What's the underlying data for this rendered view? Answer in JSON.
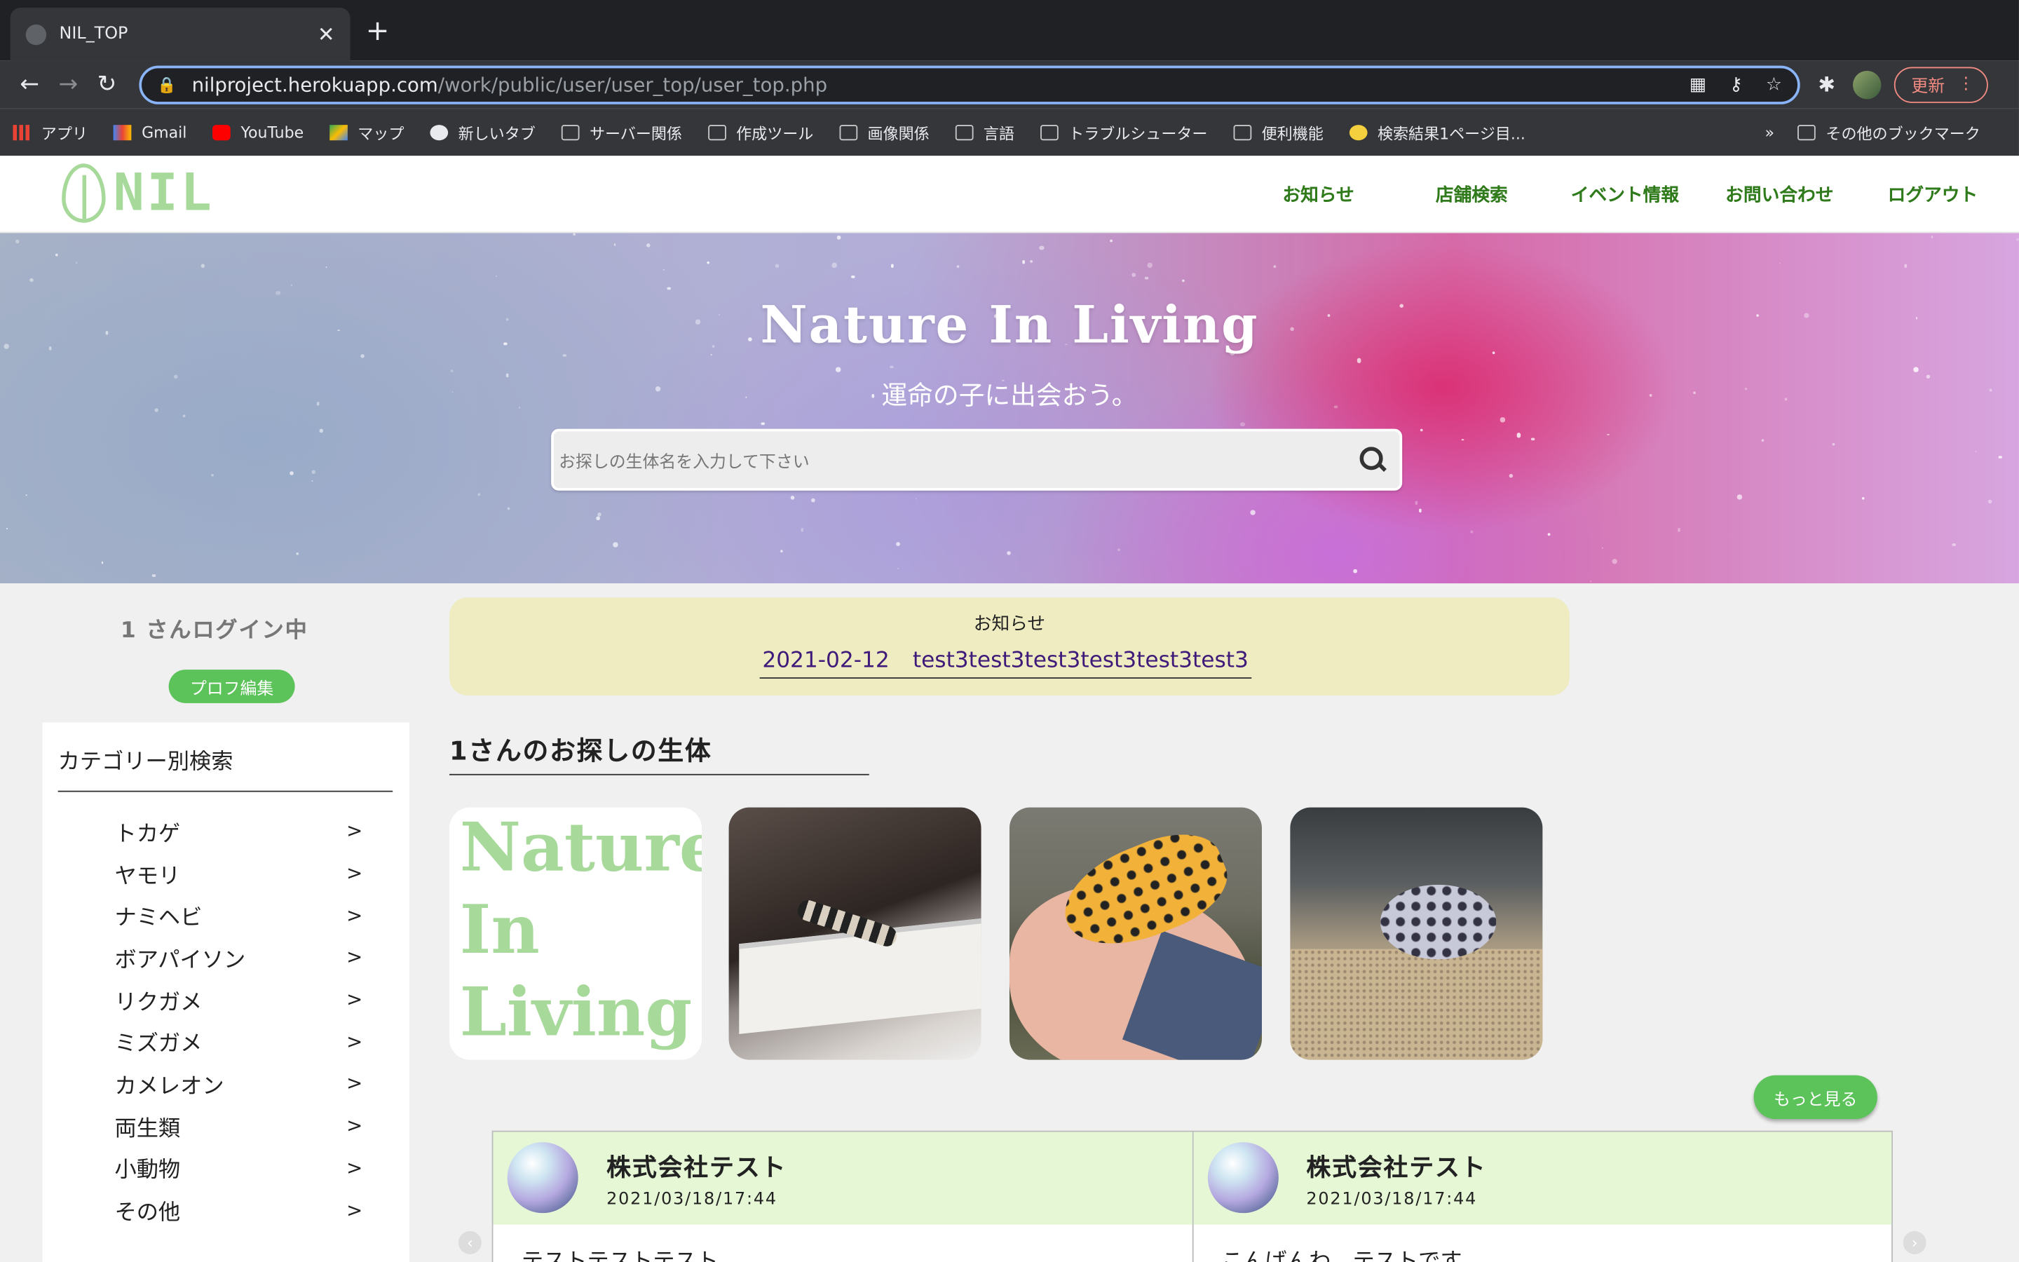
{
  "browser": {
    "tab_title": "NIL_TOP",
    "url_host": "nilproject.herokuapp.com",
    "url_path": "/work/public/user/user_top/user_top.php",
    "update_label": "更新",
    "bookmarks": [
      {
        "label": "アプリ",
        "icon": "apps-grid-icon"
      },
      {
        "label": "Gmail",
        "icon": "gmail-icon"
      },
      {
        "label": "YouTube",
        "icon": "youtube-icon"
      },
      {
        "label": "マップ",
        "icon": "maps-icon"
      },
      {
        "label": "新しいタブ",
        "icon": "globe-icon"
      },
      {
        "label": "サーバー関係",
        "icon": "folder-icon"
      },
      {
        "label": "作成ツール",
        "icon": "folder-icon"
      },
      {
        "label": "画像関係",
        "icon": "folder-icon"
      },
      {
        "label": "言語",
        "icon": "folder-icon"
      },
      {
        "label": "トラブルシューター",
        "icon": "folder-icon"
      },
      {
        "label": "便利機能",
        "icon": "folder-icon"
      },
      {
        "label": "検索結果1ページ目...",
        "icon": "smile-icon"
      }
    ],
    "more_bookmarks": "»",
    "other_bookmarks": "その他のブックマーク"
  },
  "site": {
    "logo_text": "NIL",
    "nav": [
      "お知らせ",
      "店舗検索",
      "イベント情報",
      "お問い合わせ",
      "ログアウト"
    ],
    "accent_color": "#5cc25a",
    "nav_color": "#2f7a1a"
  },
  "hero": {
    "title": "Nature In Living",
    "tagline": "運命の子に出会おう。",
    "search_placeholder": "お探しの生体名を入力して下さい"
  },
  "sidebar": {
    "login_message": "1 さんログイン中",
    "profile_button": "プロフ編集",
    "category_heading": "カテゴリー別検索",
    "arrow": ">",
    "categories": [
      "トカゲ",
      "ヤモリ",
      "ナミヘビ",
      "ボアパイソン",
      "リクガメ",
      "ミズガメ",
      "カメレオン",
      "両生類",
      "小動物",
      "その他"
    ]
  },
  "notice": {
    "heading": "お知らせ",
    "date": "2021-02-12",
    "text": "test3test3test3test3test3test3"
  },
  "wanted": {
    "title": "1さんのお探しの生体",
    "logo_thumb_lines": [
      "Nature",
      "In",
      "Living"
    ],
    "more_button": "もっと見る"
  },
  "posts": [
    {
      "name": "株式会社テスト",
      "time": "2021/03/18/17:44",
      "message": "テストテストテスト"
    },
    {
      "name": "株式会社テスト",
      "time": "2021/03/18/17:44",
      "message": "こんばんわ、テストです。"
    }
  ]
}
